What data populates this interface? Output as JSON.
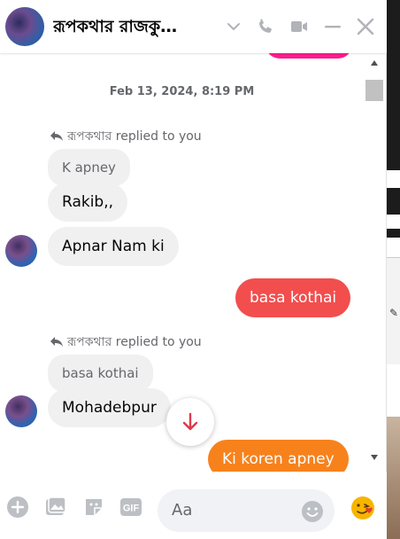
{
  "header": {
    "title": "রূপকথার রাজকু…",
    "avatar_icon": "profile-photo-avatar",
    "buttons": [
      "chevron-down-icon",
      "phone-icon",
      "video-icon",
      "minimize-icon",
      "close-icon"
    ]
  },
  "colors": {
    "accent": "#0084ff",
    "out_red": "#f24e4e",
    "out_orange": "#f7821c",
    "out_pink": "#ff1c8d",
    "bubble_in": "#f0f0f0"
  },
  "messages": {
    "timestamp": "Feb 13, 2024, 8:19 PM",
    "reply1": {
      "sender": "রূপকথার",
      "suffix": " replied to you",
      "quoted": "K apney"
    },
    "in1": "Rakib,,",
    "in2": "Apnar Nam ki",
    "out1": "basa kothai",
    "reply2": {
      "sender": "রূপকথার",
      "suffix": " replied to you",
      "quoted": "basa kothai"
    },
    "in3": "Mohadebpur",
    "out2": "Ki koren apney"
  },
  "composer": {
    "placeholder": "Aa",
    "icons": [
      "plus-circle-icon",
      "photo-icon",
      "sticker-icon",
      "gif-icon",
      "emoji-icon",
      "reaction-emoji-icon"
    ],
    "gif_label": "GIF"
  },
  "scroll_down_icon": "arrow-down-icon"
}
